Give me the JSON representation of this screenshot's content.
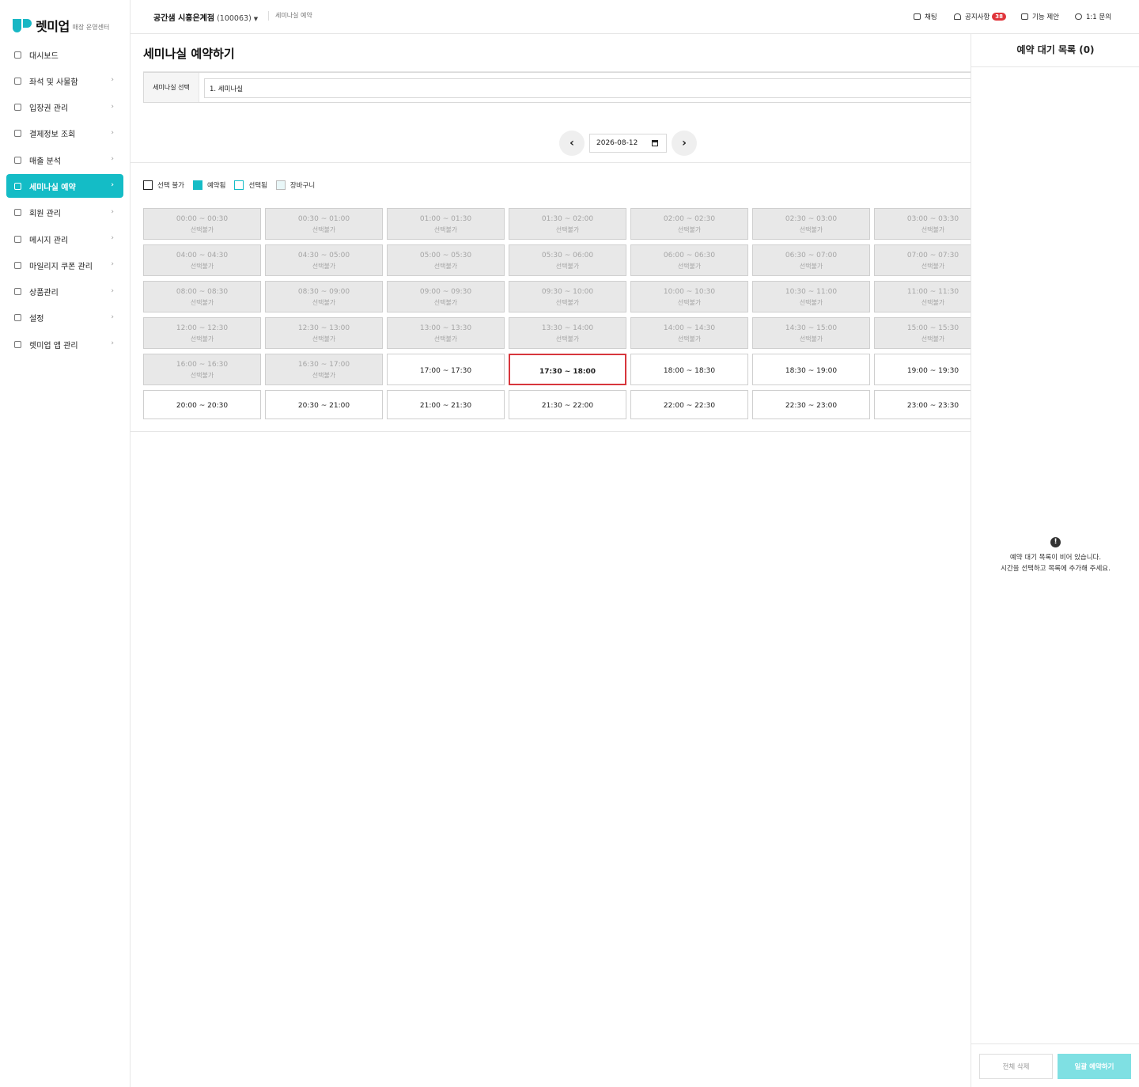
{
  "brand": {
    "name": "렛미업",
    "subtitle": "매장 운영센터"
  },
  "sidebar": {
    "items": [
      {
        "label": "대시보드",
        "icon": "grid-icon",
        "chevron": false
      },
      {
        "label": "좌석 및 사물함",
        "icon": "seat-icon",
        "chevron": true
      },
      {
        "label": "입장권 관리",
        "icon": "ticket-icon",
        "chevron": true
      },
      {
        "label": "결제정보 조회",
        "icon": "card-icon",
        "chevron": true
      },
      {
        "label": "매출 분석",
        "icon": "chart-icon",
        "chevron": true
      },
      {
        "label": "세미나실 예약",
        "icon": "calendar-icon",
        "chevron": true,
        "active": true
      },
      {
        "label": "회원 관리",
        "icon": "users-icon",
        "chevron": true
      },
      {
        "label": "메시지 관리",
        "icon": "mail-icon",
        "chevron": true
      },
      {
        "label": "마일리지 쿠폰 관리",
        "icon": "coupon-icon",
        "chevron": true
      },
      {
        "label": "상품관리",
        "icon": "box-icon",
        "chevron": true
      },
      {
        "label": "설정",
        "icon": "gear-icon",
        "chevron": true
      },
      {
        "label": "렛미업 앱 관리",
        "icon": "apps-icon",
        "chevron": true
      }
    ]
  },
  "header": {
    "store": "공간샘 시흥은계점",
    "store_code": "(100063)",
    "breadcrumb": "세미나실 예약",
    "chat": "채팅",
    "notice": "공지사항",
    "notice_count": "38",
    "suggest": "기능 제안",
    "inquiry": "1:1 문의"
  },
  "main": {
    "title": "세미나실 예약하기",
    "room_label": "세미나실 선택",
    "room_value": "1. 세미나실",
    "date": "2026-08-12",
    "legend": [
      {
        "label": "선택 불가",
        "fill": "#ffffff",
        "border": "#222222"
      },
      {
        "label": "예약됨",
        "fill": "#14bcc6",
        "border": "#14bcc6"
      },
      {
        "label": "선택됨",
        "fill": "#ffffff",
        "border": "#14bcc6"
      },
      {
        "label": "장바구니",
        "fill": "#e9f7f8",
        "border": "#bbbbbb"
      }
    ],
    "unavailable_text": "선택불가",
    "slots": [
      {
        "time": "00:00 ~ 00:30",
        "state": "disabled"
      },
      {
        "time": "00:30 ~ 01:00",
        "state": "disabled"
      },
      {
        "time": "01:00 ~ 01:30",
        "state": "disabled"
      },
      {
        "time": "01:30 ~ 02:00",
        "state": "disabled"
      },
      {
        "time": "02:00 ~ 02:30",
        "state": "disabled"
      },
      {
        "time": "02:30 ~ 03:00",
        "state": "disabled"
      },
      {
        "time": "03:00 ~ 03:30",
        "state": "disabled"
      },
      {
        "time": "04:00 ~ 04:30",
        "state": "disabled"
      },
      {
        "time": "04:30 ~ 05:00",
        "state": "disabled"
      },
      {
        "time": "05:00 ~ 05:30",
        "state": "disabled"
      },
      {
        "time": "05:30 ~ 06:00",
        "state": "disabled"
      },
      {
        "time": "06:00 ~ 06:30",
        "state": "disabled"
      },
      {
        "time": "06:30 ~ 07:00",
        "state": "disabled"
      },
      {
        "time": "07:00 ~ 07:30",
        "state": "disabled"
      },
      {
        "time": "08:00 ~ 08:30",
        "state": "disabled"
      },
      {
        "time": "08:30 ~ 09:00",
        "state": "disabled"
      },
      {
        "time": "09:00 ~ 09:30",
        "state": "disabled"
      },
      {
        "time": "09:30 ~ 10:00",
        "state": "disabled"
      },
      {
        "time": "10:00 ~ 10:30",
        "state": "disabled"
      },
      {
        "time": "10:30 ~ 11:00",
        "state": "disabled"
      },
      {
        "time": "11:00 ~ 11:30",
        "state": "disabled"
      },
      {
        "time": "12:00 ~ 12:30",
        "state": "disabled"
      },
      {
        "time": "12:30 ~ 13:00",
        "state": "disabled"
      },
      {
        "time": "13:00 ~ 13:30",
        "state": "disabled"
      },
      {
        "time": "13:30 ~ 14:00",
        "state": "disabled"
      },
      {
        "time": "14:00 ~ 14:30",
        "state": "disabled"
      },
      {
        "time": "14:30 ~ 15:00",
        "state": "disabled"
      },
      {
        "time": "15:00 ~ 15:30",
        "state": "disabled"
      },
      {
        "time": "16:00 ~ 16:30",
        "state": "disabled"
      },
      {
        "time": "16:30 ~ 17:00",
        "state": "disabled"
      },
      {
        "time": "17:00 ~ 17:30",
        "state": "open"
      },
      {
        "time": "17:30 ~ 18:00",
        "state": "focused"
      },
      {
        "time": "18:00 ~ 18:30",
        "state": "open"
      },
      {
        "time": "18:30 ~ 19:00",
        "state": "open"
      },
      {
        "time": "19:00 ~ 19:30",
        "state": "open"
      },
      {
        "time": "20:00 ~ 20:30",
        "state": "open"
      },
      {
        "time": "20:30 ~ 21:00",
        "state": "open"
      },
      {
        "time": "21:00 ~ 21:30",
        "state": "open"
      },
      {
        "time": "21:30 ~ 22:00",
        "state": "open"
      },
      {
        "time": "22:00 ~ 22:30",
        "state": "open"
      },
      {
        "time": "22:30 ~ 23:00",
        "state": "open"
      },
      {
        "time": "23:00 ~ 23:30",
        "state": "open"
      }
    ]
  },
  "panel": {
    "title": "예약 대기 목록 (0)",
    "empty_line1": "예약 대기 목록이 비어 있습니다.",
    "empty_line2": "시간을 선택하고 목록에 추가해 주세요.",
    "clear_all": "전체 삭제",
    "book_all": "일괄 예약하기"
  },
  "colors": {
    "accent": "#14bcc6",
    "selected_border": "#d7363c",
    "badge": "#e0343a"
  }
}
